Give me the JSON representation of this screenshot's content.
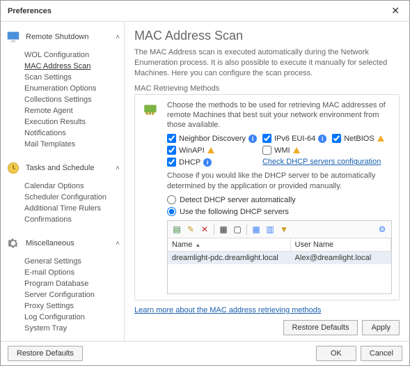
{
  "window": {
    "title": "Preferences"
  },
  "sidebar": {
    "groups": [
      {
        "label": "Remote Shutdown",
        "icon": "monitor",
        "items": [
          "WOL Configuration",
          "MAC Address Scan",
          "Scan Settings",
          "Enumeration Options",
          "Collections Settings",
          "Remote Agent",
          "Execution Results",
          "Notifications",
          "Mail Templates"
        ],
        "selected": 1
      },
      {
        "label": "Tasks and Schedule",
        "icon": "clock",
        "items": [
          "Calendar Options",
          "Scheduler Configuration",
          "Additional Time Rulers",
          "Confirmations"
        ]
      },
      {
        "label": "Miscellaneous",
        "icon": "gear",
        "items": [
          "General Settings",
          "E-mail Options",
          "Program Database",
          "Server Configuration",
          "Proxy Settings",
          "Log Configuration",
          "System Tray"
        ]
      }
    ]
  },
  "page": {
    "heading": "MAC Address Scan",
    "description": "The MAC Address scan is executed automatically during the Network Enumeration process. It is also possible to execute it manually for selected Machines. Here you can configure the scan process.",
    "fieldset_label": "MAC Retrieving Methods",
    "fieldset_intro": "Choose the methods to be used for retrieving MAC addresses of remote Machines that best suit your network environment from those available.",
    "checks": {
      "neighbor": "Neighbor Discovery",
      "ipv6": "IPv6 EUI-64",
      "netbios": "NetBIOS",
      "winapi": "WinAPI",
      "wmi": "WMI",
      "dhcp": "DHCP"
    },
    "dhcp_link": "Check DHCP servers configuration",
    "dhcp_desc": "Choose if you would like the DHCP server to be automatically determined by the application or provided manually.",
    "radio_auto": "Detect DHCP server automatically",
    "radio_manual": "Use the following DHCP servers",
    "table": {
      "col_name": "Name",
      "col_user": "User Name",
      "rows": [
        {
          "name": "dreamlight-pdc.dreamlight.local",
          "user": "Alex@dreamlight.local"
        }
      ]
    },
    "learn_link": "Learn more about the MAC address retrieving methods",
    "restore": "Restore Defaults",
    "apply": "Apply"
  },
  "footer": {
    "restore": "Restore Defaults",
    "ok": "OK",
    "cancel": "Cancel"
  }
}
